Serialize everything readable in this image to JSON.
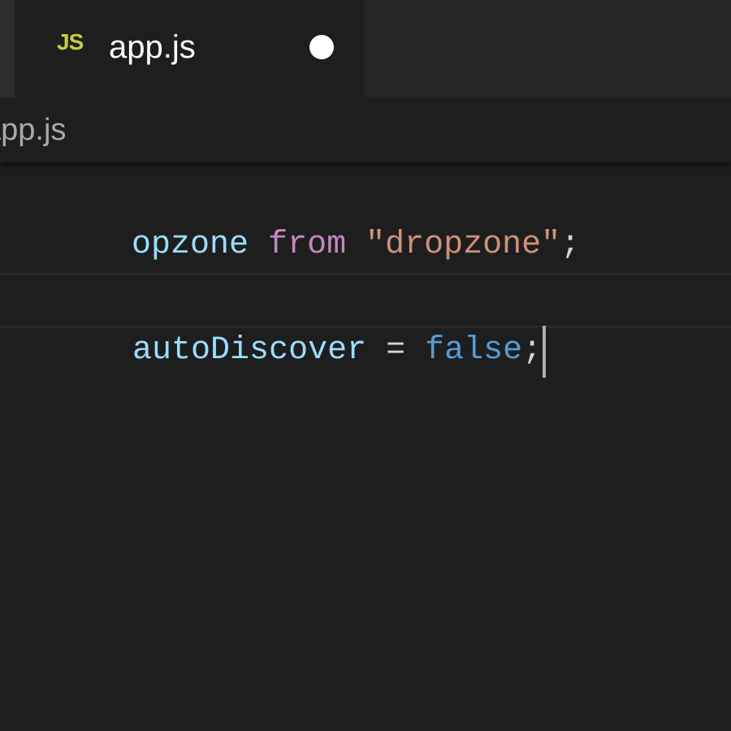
{
  "tab": {
    "icon_text": "JS",
    "label": "app.js",
    "dirty_indicator": "unsaved-dot"
  },
  "breadcrumb": {
    "file": "app.js"
  },
  "editor": {
    "lines": [
      {
        "tokens": [
          {
            "text": "opzone",
            "kind": "variable"
          },
          {
            "text": " ",
            "kind": "space"
          },
          {
            "text": "from",
            "kind": "keyword"
          },
          {
            "text": " ",
            "kind": "space"
          },
          {
            "text": "\"dropzone\"",
            "kind": "string"
          },
          {
            "text": ";",
            "kind": "punctuation"
          }
        ]
      },
      {
        "tokens": []
      },
      {
        "tokens": [
          {
            "text": "autoDiscover",
            "kind": "variable"
          },
          {
            "text": " = ",
            "kind": "operator"
          },
          {
            "text": "false",
            "kind": "boolean"
          },
          {
            "text": ";",
            "kind": "punctuation"
          }
        ],
        "has_cursor": true
      }
    ]
  },
  "colors": {
    "background": "#1e1e1e",
    "tab_bar": "#252526",
    "js_icon": "#cbcb41",
    "variable": "#9cdcfe",
    "keyword": "#c586c0",
    "string": "#ce9178",
    "boolean": "#569cd6",
    "operator": "#d4d4d4"
  }
}
